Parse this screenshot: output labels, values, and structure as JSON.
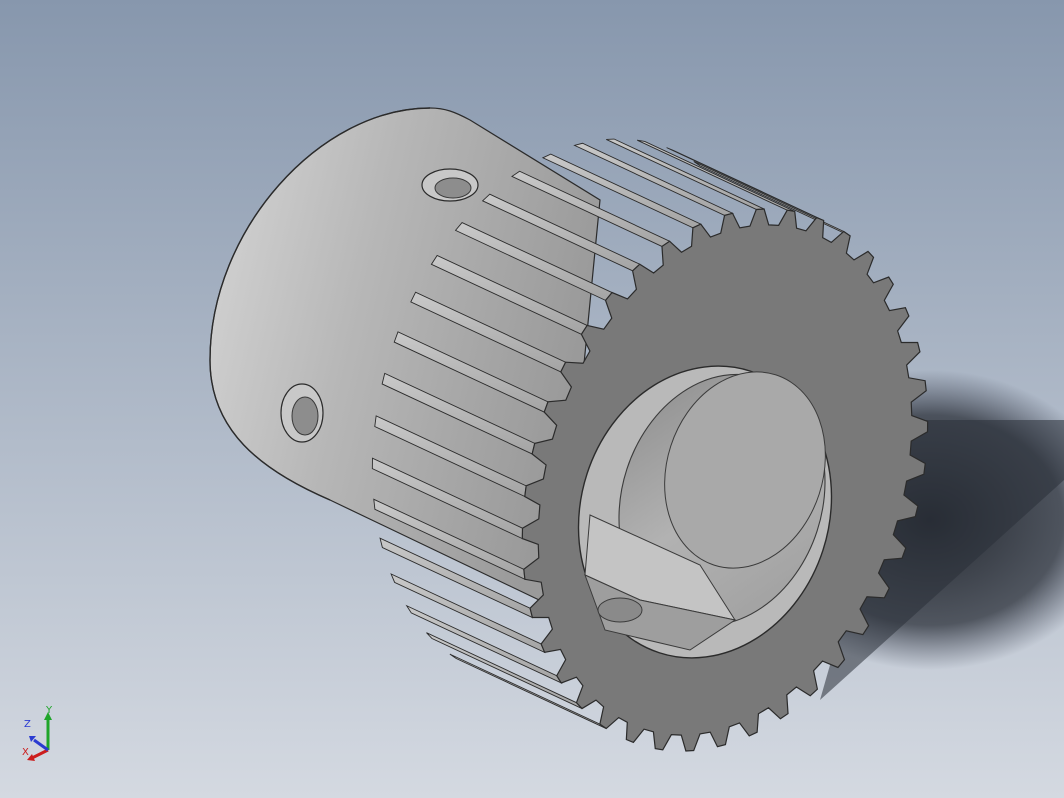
{
  "viewport": {
    "background_top": "#8797ad",
    "background_bottom": "#d4d9e1",
    "part_color": "#a8a8a8",
    "shadow_color": "#1f232a"
  },
  "model": {
    "part": "helical-gear-with-hub",
    "gear_teeth_visible": 40,
    "hub_set_screw_holes": 2,
    "bore_keyway": true
  },
  "triad": {
    "x_label": "X",
    "y_label": "Y",
    "z_label": "Z",
    "x_color": "#cc1d1d",
    "y_color": "#1fa52a",
    "z_color": "#2a3bd1"
  }
}
